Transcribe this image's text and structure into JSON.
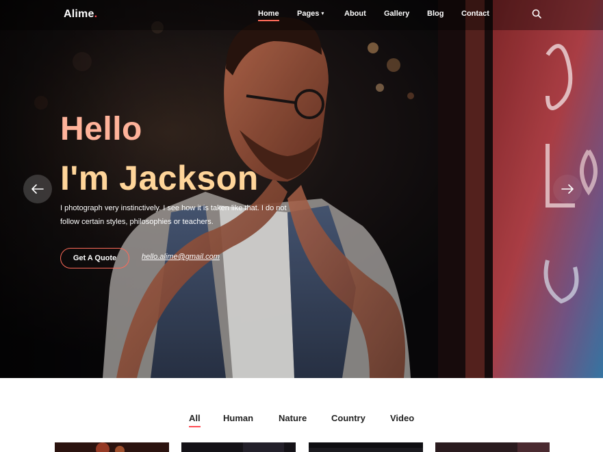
{
  "brand": {
    "name": "Alime",
    "dot": ".",
    "accent_color": "#ff4a52"
  },
  "nav": {
    "items": [
      {
        "label": "Home",
        "active": true
      },
      {
        "label": "Pages",
        "has_dropdown": true
      },
      {
        "label": "About"
      },
      {
        "label": "Gallery"
      },
      {
        "label": "Blog"
      },
      {
        "label": "Contact"
      }
    ],
    "search_icon": "search-icon"
  },
  "hero": {
    "greeting": "Hello",
    "headline": "I'm Jackson",
    "intro_line1": "I photograph very instinctively. I see how it is taken like that. I do not",
    "intro_line2": "follow certain styles, philosophies or teachers.",
    "cta_label": "Get A Quote",
    "email": "hello.alime@gmail.com",
    "prev_icon": "arrow-left-icon",
    "next_icon": "arrow-right-icon",
    "greeting_color": "#ffb39a",
    "headline_color": "#ffd59a"
  },
  "filters": {
    "tabs": [
      {
        "label": "All",
        "active": true
      },
      {
        "label": "Human"
      },
      {
        "label": "Nature"
      },
      {
        "label": "Country"
      },
      {
        "label": "Video"
      }
    ]
  }
}
